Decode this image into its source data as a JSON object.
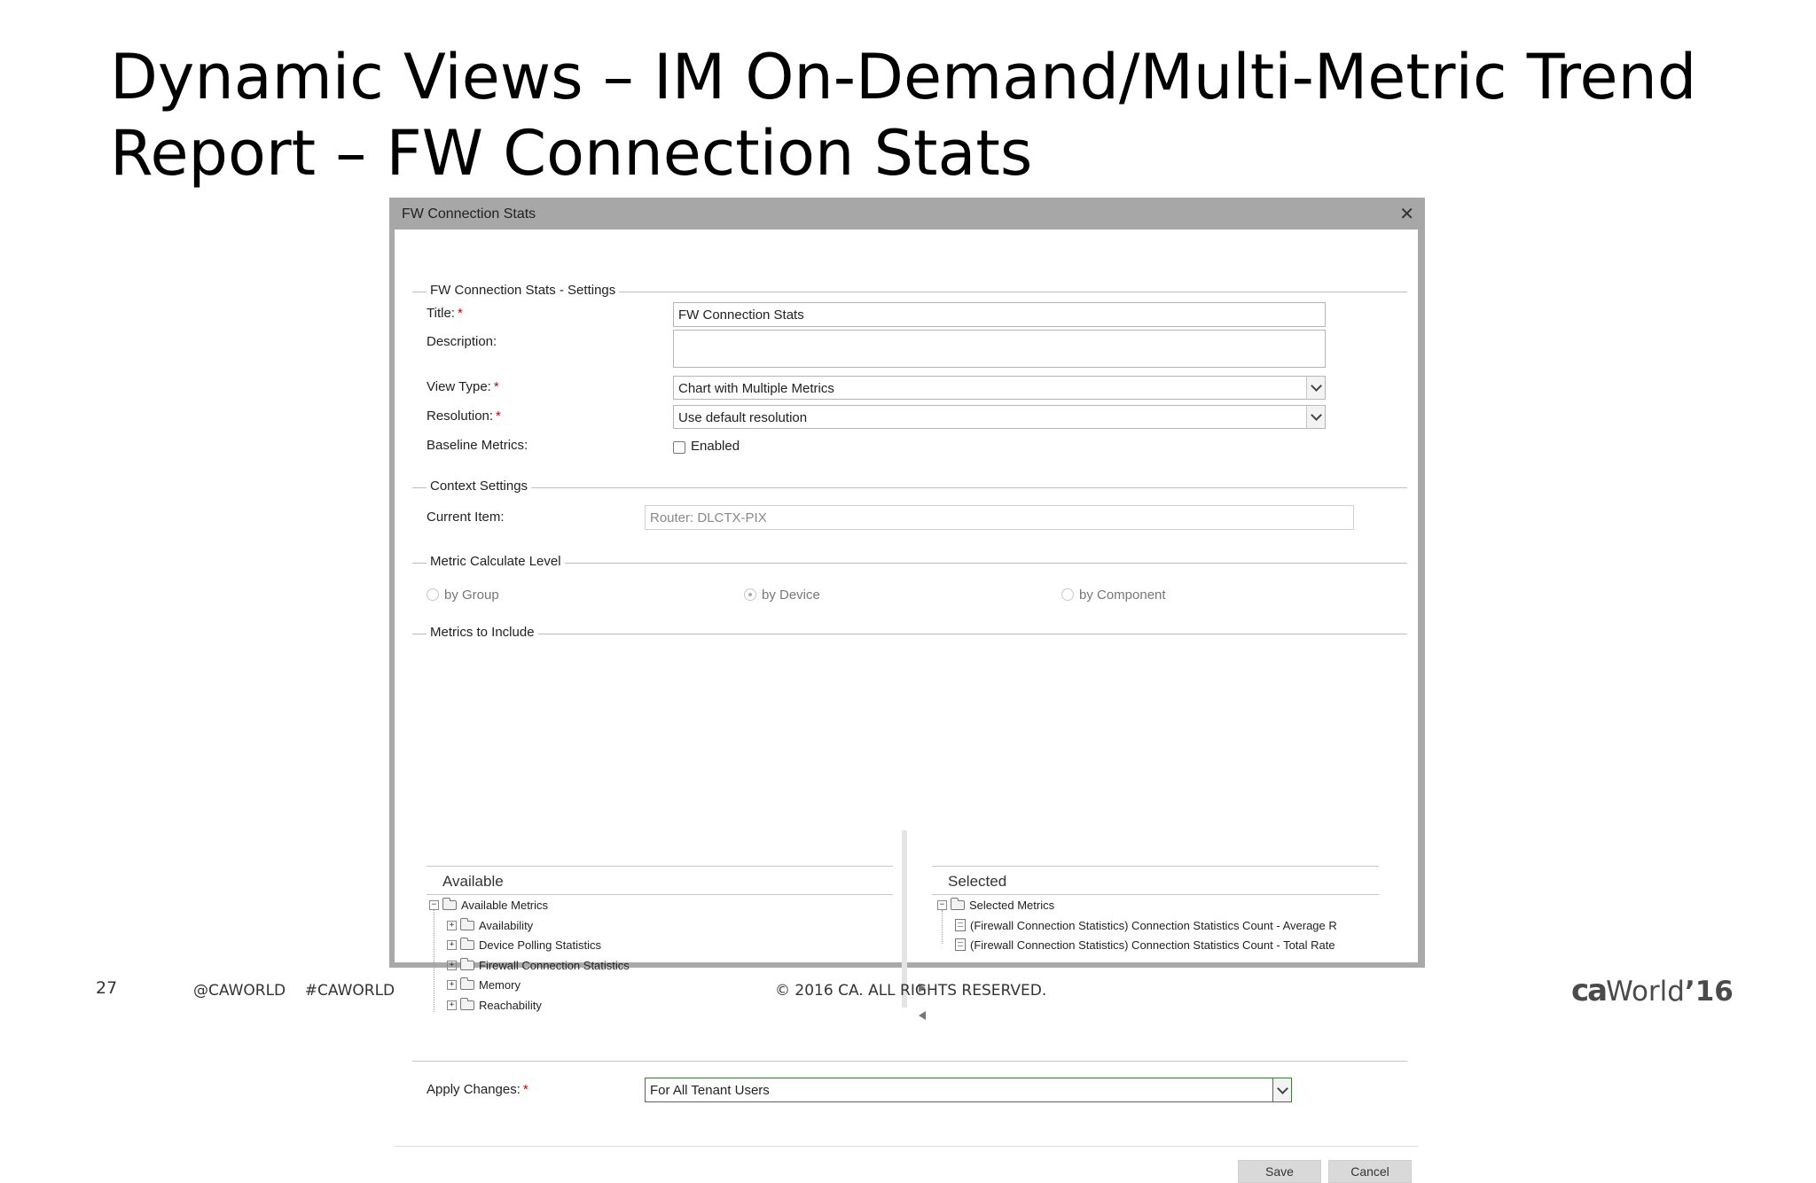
{
  "slide": {
    "title_line1": "Dynamic Views – IM On-Demand/Multi-Metric Trend",
    "title_line2": "Report – FW Connection Stats",
    "page_number": "27",
    "social": "@CAWORLD    #CAWORLD",
    "copyright": "© 2016 CA. ALL RIGHTS RESERVED.",
    "logo": {
      "brand": "ca",
      "word": "World",
      "year": "’16"
    }
  },
  "dialog": {
    "title": "FW Connection Stats",
    "close_icon": "close-icon",
    "settings": {
      "section_title": "FW Connection Stats - Settings",
      "title_label": "Title:",
      "title_value": "FW Connection Stats",
      "description_label": "Description:",
      "description_value": "",
      "view_type_label": "View Type:",
      "view_type_value": "Chart with Multiple Metrics",
      "resolution_label": "Resolution:",
      "resolution_value": "Use default resolution",
      "baseline_label": "Baseline Metrics:",
      "baseline_option": "Enabled",
      "baseline_checked": false,
      "required_mark": "*"
    },
    "context": {
      "section_title": "Context Settings",
      "current_item_label": "Current Item:",
      "current_item_value": "Router: DLCTX-PIX"
    },
    "calc_level": {
      "section_title": "Metric Calculate Level",
      "options": [
        "by Group",
        "by Device",
        "by Component"
      ],
      "selected": "by Device"
    },
    "metrics": {
      "section_title": "Metrics to Include",
      "available_header": "Available",
      "available_root": "Available Metrics",
      "available_items": [
        "Availability",
        "Device Polling Statistics",
        "Firewall Connection Statistics",
        "Memory",
        "Reachability"
      ],
      "selected_header": "Selected",
      "selected_root": "Selected Metrics",
      "selected_items": [
        "(Firewall Connection Statistics) Connection Statistics Count - Average R",
        "(Firewall Connection Statistics) Connection Statistics Count - Total Rate"
      ]
    },
    "apply": {
      "label": "Apply Changes:",
      "value": "For All Tenant Users"
    },
    "buttons": {
      "save": "Save",
      "cancel": "Cancel"
    }
  },
  "colors": {
    "accent_border": "#3a7a3a",
    "required": "#cc0000",
    "dialog_frame": "#a9a9a9"
  }
}
